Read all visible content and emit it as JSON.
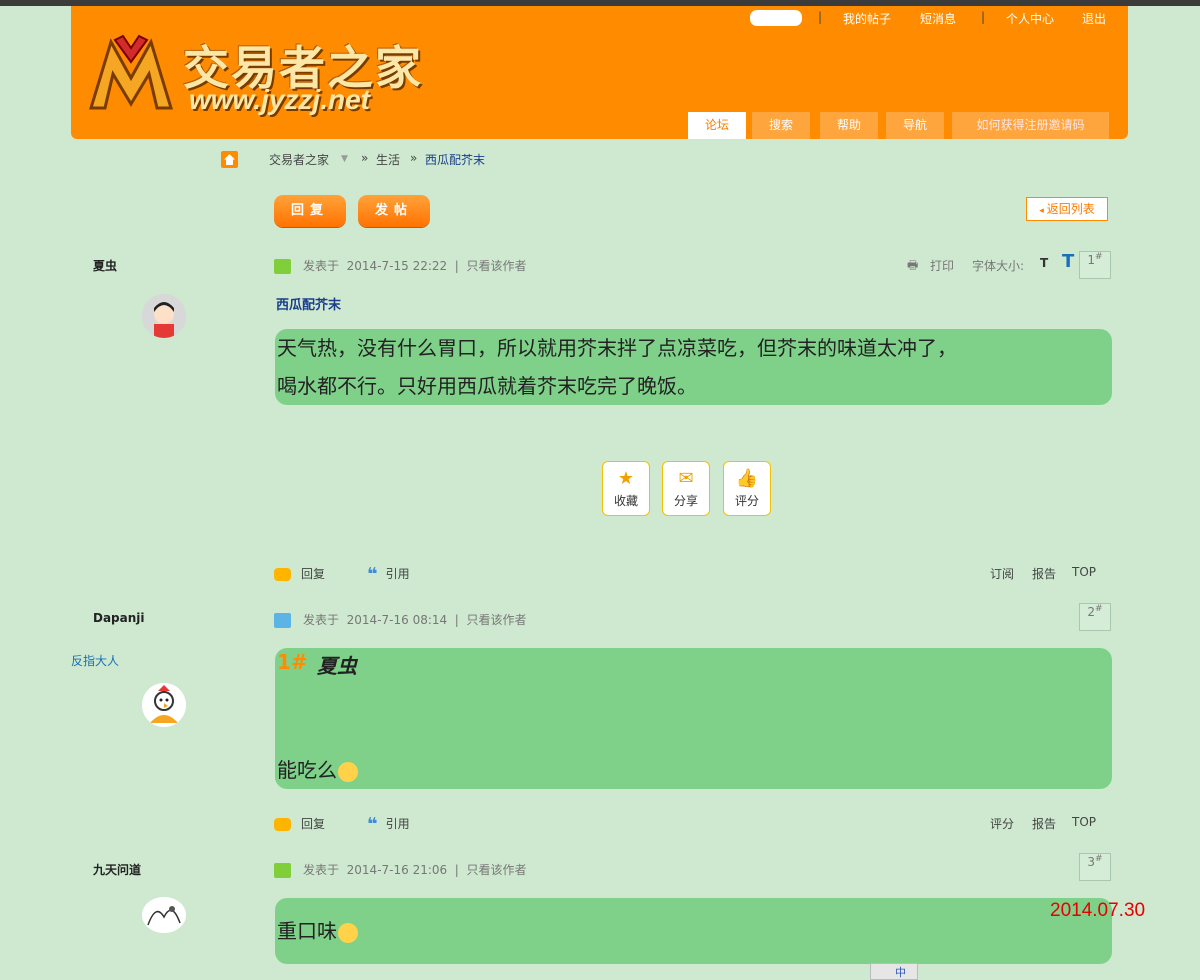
{
  "header": {
    "logo_cn": "交易者之家",
    "logo_url": "www.jyzzj.net",
    "topnav": [
      "我的帖子",
      "短消息",
      "个人中心",
      "退出"
    ],
    "tabs": [
      "论坛",
      "搜索",
      "帮助",
      "导航",
      "如何获得注册邀请码"
    ]
  },
  "breadcrumb": {
    "items": [
      "交易者之家",
      "生活",
      "西瓜配芥末"
    ],
    "sep": "»"
  },
  "toolbar": {
    "reply": "回复",
    "newpost": "发帖",
    "back": "返回列表"
  },
  "post_common": {
    "posted_at_label": "发表于",
    "only_author": "只看该作者",
    "reply": "回复",
    "quote": "引用",
    "report": "报告",
    "top": "TOP"
  },
  "posts": [
    {
      "author": "夏虫",
      "time": "2014-7-15 22:22",
      "print": "打印",
      "fontsize_label": "字体大小:",
      "fontsize_small": "T",
      "fontsize_large": "T",
      "floor": "1",
      "title": "西瓜配芥末",
      "body": [
        "天气热，没有什么胃口，所以就用芥末拌了点凉菜吃，但芥末的味道太冲了，",
        "喝水都不行。只好用西瓜就着芥末吃完了晚饭。"
      ],
      "actions": [
        "收藏",
        "分享",
        "评分"
      ],
      "right1": "订阅"
    },
    {
      "author": "Dapanji",
      "user_title": "反指大人",
      "time": "2014-7-16 08:14",
      "floor": "2",
      "quote_floor": "1#",
      "quote_author": "夏虫",
      "body": "能吃么",
      "right1": "评分"
    },
    {
      "author": "九天问道",
      "time": "2014-7-16 21:06",
      "floor": "3",
      "body": "重口味"
    }
  ],
  "stamp": "2014.07.30",
  "ime": "中",
  "colors": {
    "page_bg": "#cee9d0",
    "header_orange": "#ff8c00",
    "bubble_green": "#7fd18a",
    "link_blue": "#1a3e8c",
    "stamp_red": "#e60000"
  }
}
